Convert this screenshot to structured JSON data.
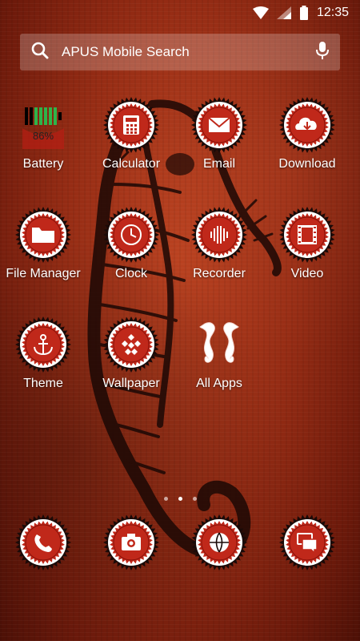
{
  "status_bar": {
    "time": "12:35",
    "icons": [
      "wifi-icon",
      "signal-icon",
      "battery-icon"
    ]
  },
  "search": {
    "label": "APUS Mobile Search",
    "left_icon": "search-icon",
    "right_icon": "mic-icon"
  },
  "apps": [
    {
      "label": "Battery",
      "icon": "battery-widget-icon",
      "percent": "86%"
    },
    {
      "label": "Calculator",
      "icon": "calculator-icon"
    },
    {
      "label": "Email",
      "icon": "email-icon"
    },
    {
      "label": "Download",
      "icon": "download-icon"
    },
    {
      "label": "File Manager",
      "icon": "folder-icon"
    },
    {
      "label": "Clock",
      "icon": "clock-icon"
    },
    {
      "label": "Recorder",
      "icon": "recorder-icon"
    },
    {
      "label": "Video",
      "icon": "video-icon"
    },
    {
      "label": "Theme",
      "icon": "anchor-icon"
    },
    {
      "label": "Wallpaper",
      "icon": "wallpaper-icon"
    },
    {
      "label": "All Apps",
      "icon": "seahorse-icon"
    }
  ],
  "page_indicator": {
    "count": 3,
    "active": 2
  },
  "dock": [
    {
      "icon": "phone-icon"
    },
    {
      "icon": "camera-icon"
    },
    {
      "icon": "browser-icon"
    },
    {
      "icon": "messages-icon"
    }
  ],
  "colors": {
    "background": "#962c14",
    "badge_white": "#ffffff",
    "badge_red": "#c0281a",
    "badge_dark": "#1a0a08",
    "battery_green": "#2fb34a"
  }
}
